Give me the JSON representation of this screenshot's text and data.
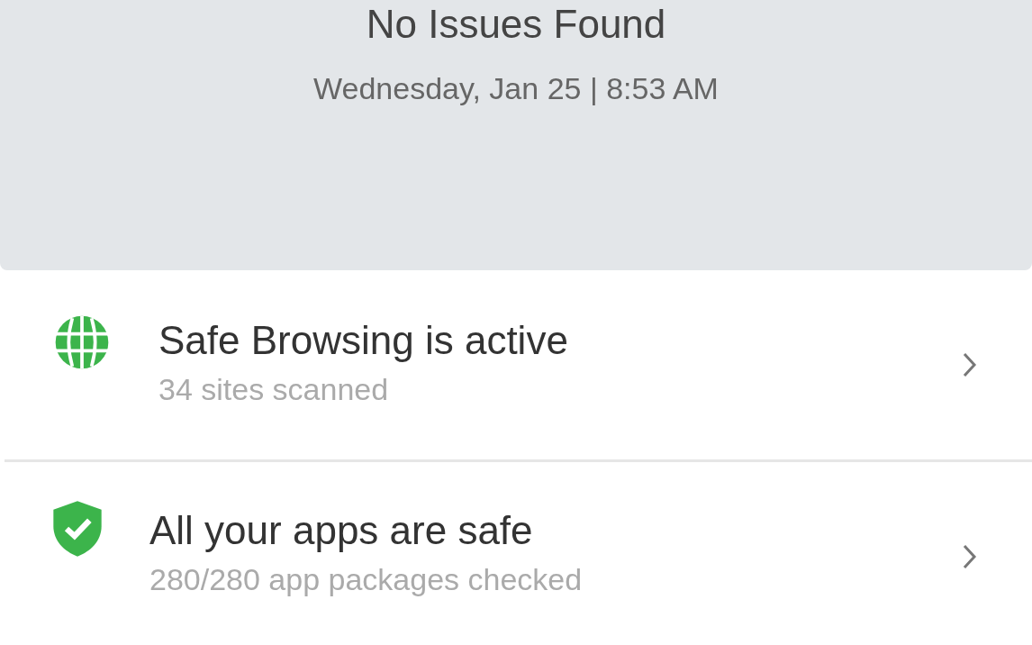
{
  "header": {
    "status": "No Issues Found",
    "timestamp": "Wednesday, Jan 25 | 8:53 AM"
  },
  "items": [
    {
      "kind": "globe",
      "title": "Safe Browsing is active",
      "subtitle": "34 sites scanned"
    },
    {
      "kind": "shield",
      "title": "All your apps are safe",
      "subtitle": "280/280 app packages checked"
    }
  ]
}
